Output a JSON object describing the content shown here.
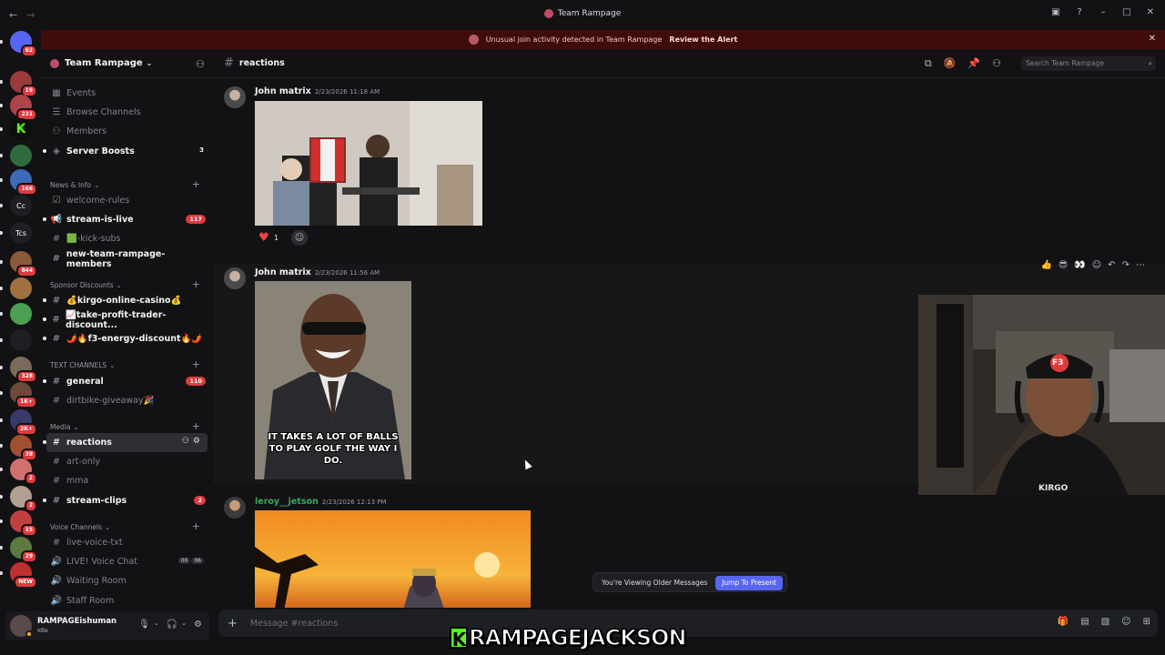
{
  "window": {
    "title": "Team Rampage"
  },
  "alert": {
    "text": "Unusual join activity detected in Team Rampage",
    "link": "Review the Alert"
  },
  "server": {
    "name": "Team Rampage"
  },
  "rail": [
    {
      "label": "",
      "badge": "62"
    },
    {
      "label": "",
      "badge": "19"
    },
    {
      "label": "",
      "badge": "231"
    },
    {
      "label": "K",
      "badge": ""
    },
    {
      "label": "",
      "badge": ""
    },
    {
      "label": "",
      "badge": "166"
    },
    {
      "label": "Cc",
      "badge": ""
    },
    {
      "label": "Tcs",
      "badge": ""
    },
    {
      "label": "",
      "badge": "844"
    },
    {
      "label": "",
      "badge": ""
    },
    {
      "label": "",
      "badge": ""
    },
    {
      "label": "",
      "badge": ""
    },
    {
      "label": "",
      "badge": "328"
    },
    {
      "label": "",
      "badge": "1K+"
    },
    {
      "label": "",
      "badge": "2K+"
    },
    {
      "label": "",
      "badge": "38"
    },
    {
      "label": "",
      "badge": "2"
    },
    {
      "label": "",
      "badge": "2"
    },
    {
      "label": "",
      "badge": "15"
    },
    {
      "label": "",
      "badge": "29"
    },
    {
      "label": "",
      "badge": "NEW"
    }
  ],
  "sidebar": {
    "top": [
      "Events",
      "Browse Channels",
      "Members",
      "Server Boosts"
    ],
    "server_boosts_count": "3",
    "cat_news": "News & Info",
    "news": [
      "welcome-rules",
      "stream-is-live",
      "🟩-kick-subs",
      "new-team-rampage-members"
    ],
    "stream_badge": "117",
    "cat_sponsor": "Sponsor Discounts",
    "sponsor": [
      "💰kirgo-online-casino💰",
      "📈take-profit-trader-discount...",
      "🌶️🔥f3-energy-discount🔥🌶️"
    ],
    "cat_text": "TEXT CHANNELS",
    "text": [
      "general",
      "dirtbike-giveaway🎉"
    ],
    "general_badge": "110",
    "cat_media": "Media",
    "media": [
      "reactions",
      "art-only",
      "mma",
      "stream-clips"
    ],
    "clips_badge": "2",
    "cat_voice": "Voice Channels",
    "voice": [
      "live-voice-txt",
      "LIVE! Voice Chat",
      "Waiting Room",
      "Staff Room"
    ],
    "voice_counts": [
      "00",
      "06"
    ]
  },
  "user": {
    "name": "RAMPAGEishuman",
    "status": "Idle"
  },
  "channel": {
    "name": "reactions",
    "search_placeholder": "Search Team Rampage"
  },
  "messages": [
    {
      "author": "John matrix",
      "time": "2/23/2026 11:18 AM",
      "reaction_count": "1"
    },
    {
      "author": "John matrix",
      "time": "2/23/2026 11:56 AM",
      "meme_text": "IT TAKES A LOT OF BALLS TO PLAY GOLF THE WAY I DO."
    },
    {
      "author": "leroy__jetson",
      "time": "2/23/2026 12:13 PM"
    }
  ],
  "older": {
    "text": "You're Viewing Older Messages",
    "button": "Jump To Present"
  },
  "composer": {
    "placeholder": "Message #reactions"
  },
  "overlay": {
    "logo": "K",
    "text": "RAMPAGEJACKSON"
  },
  "webcam": {
    "cap": "F3",
    "shirt": "KIRGO"
  },
  "colors": {
    "accent": "#5865f2",
    "alert_bg": "#3f0b0b",
    "badge": "#e03a3e",
    "leroy_name": "#3ba55d",
    "kick_green": "#53fc18"
  }
}
